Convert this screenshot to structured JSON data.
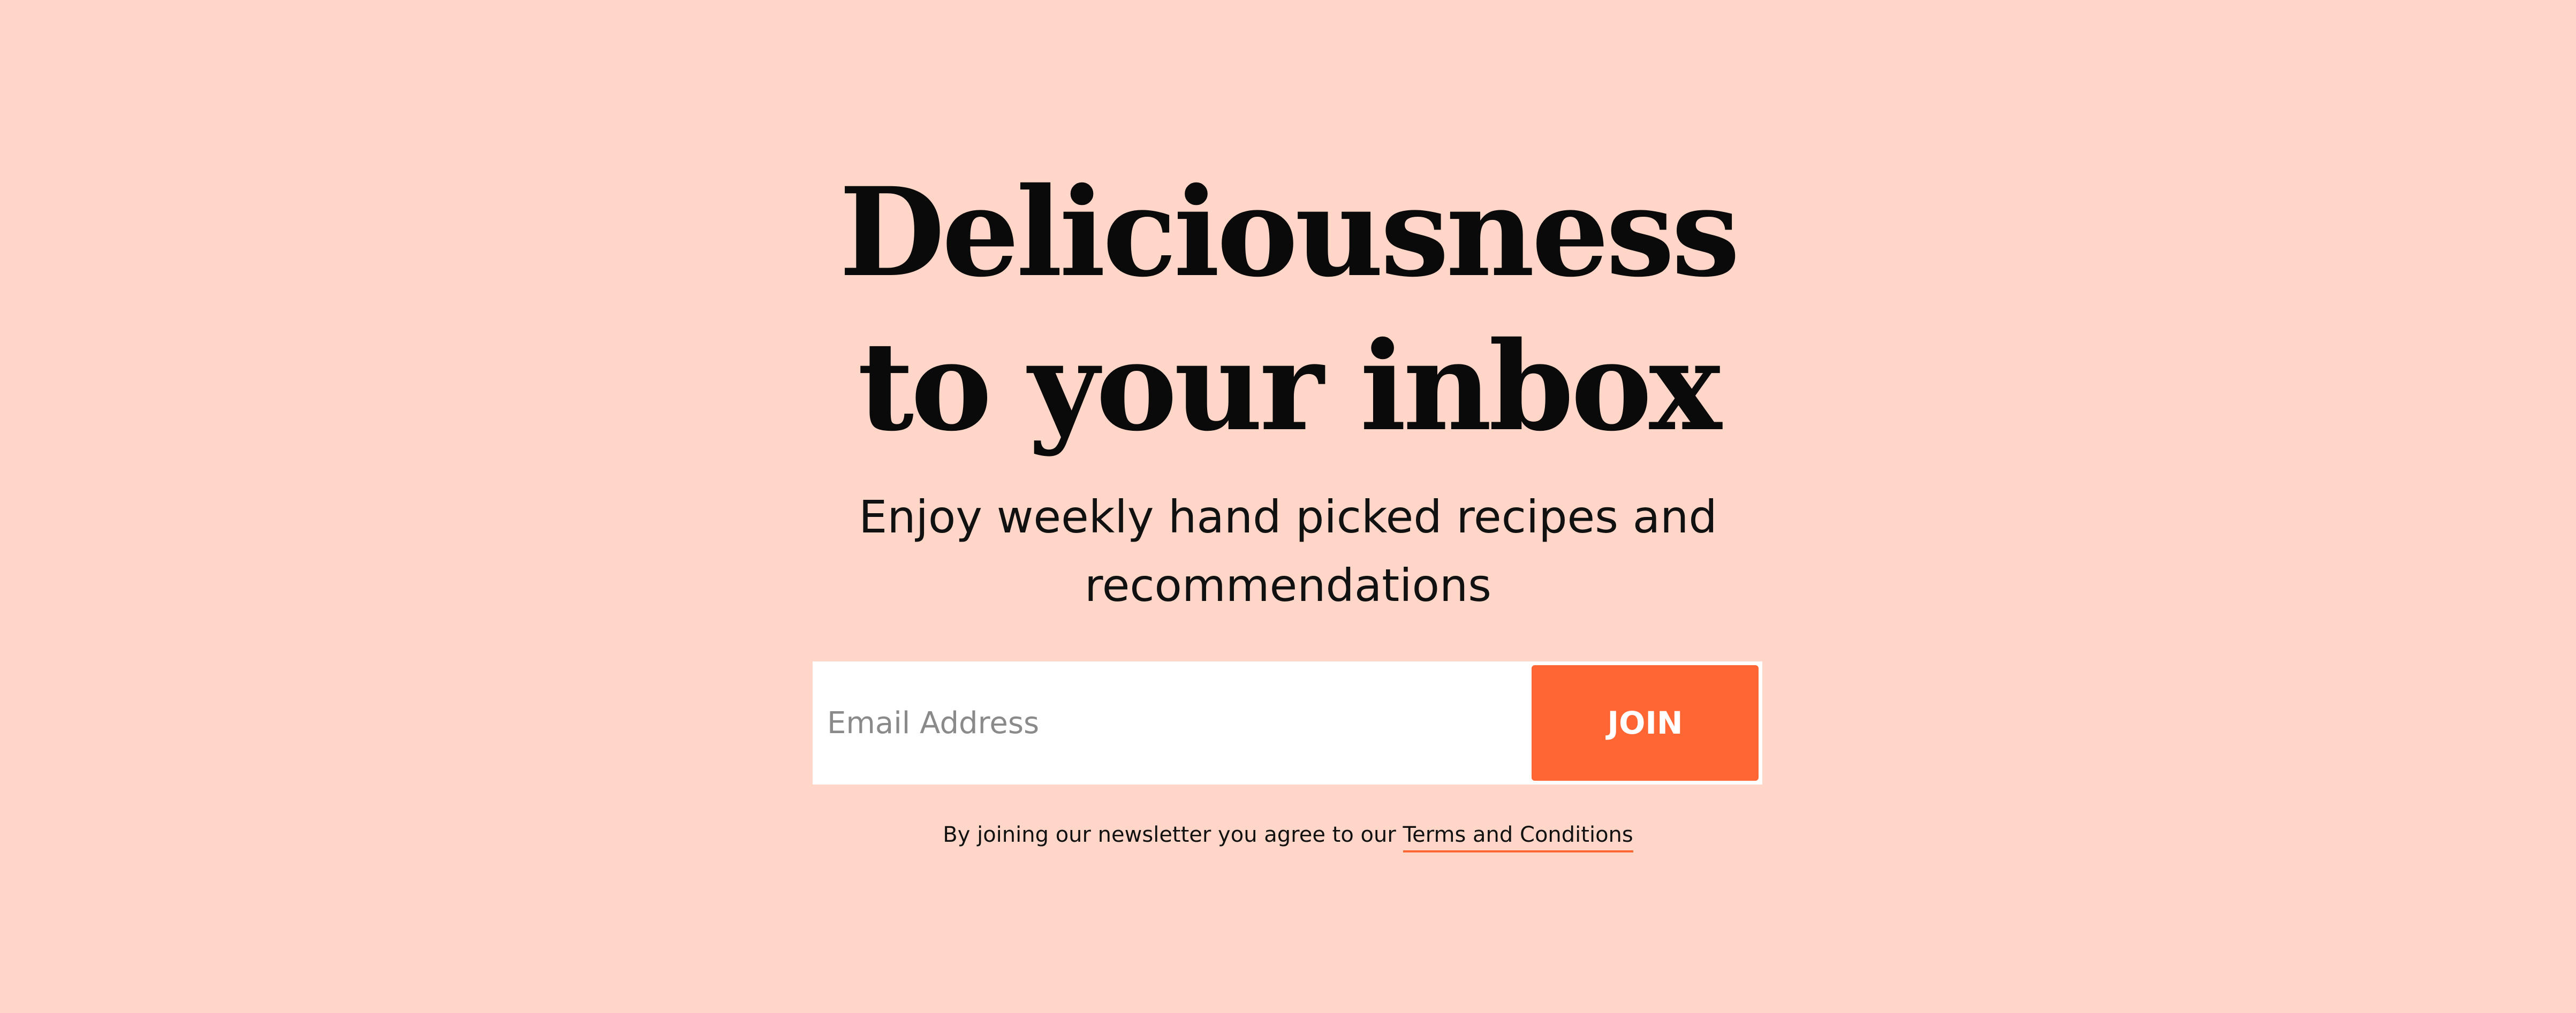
{
  "headline": {
    "line1": "Deliciousness",
    "line2": "to your inbox"
  },
  "subhead": {
    "line1": "Enjoy weekly hand picked recipes and",
    "line2": "recommendations"
  },
  "signup": {
    "email_placeholder": "Email Address",
    "email_value": "",
    "join_label": "JOIN"
  },
  "legal": {
    "prefix": "By joining our newsletter you agree to our",
    "terms_link": "Terms and Conditions"
  },
  "colors": {
    "background": "#FFD6C8",
    "accent": "#FF6633",
    "text": "#0A0A0A",
    "input_background": "#FFFFFF"
  }
}
